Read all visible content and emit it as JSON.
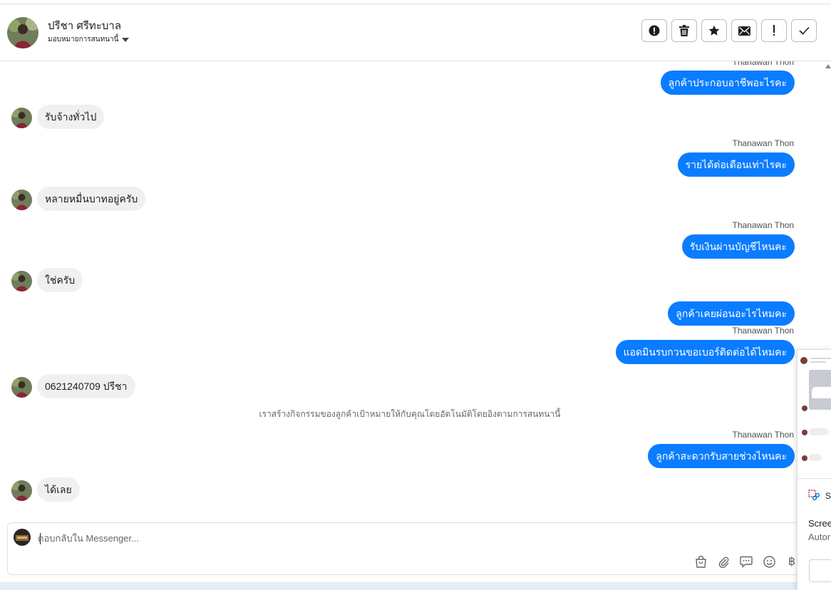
{
  "header": {
    "contact_name": "ปรีชา ศรีทะบาล",
    "assign_label": "มอบหมายการสนทนานี้",
    "actions": [
      {
        "id": "report",
        "icon": "alert-circle-icon"
      },
      {
        "id": "delete",
        "icon": "trash-icon"
      },
      {
        "id": "star",
        "icon": "star-icon"
      },
      {
        "id": "mail",
        "icon": "envelope-icon"
      },
      {
        "id": "important",
        "icon": "exclamation-icon"
      },
      {
        "id": "done",
        "icon": "check-icon"
      }
    ]
  },
  "messages": {
    "top_sender": "Thanawan Thon",
    "out_1": "ลูกค้าประกอบอาชีพอะไรคะ",
    "in_1": "รับจ้างทั่วไป",
    "sender_2": "Thanawan Thon",
    "out_2": "รายได้ต่อเดือนเท่าไรคะ",
    "in_2": "หลายหมื่นบาทอยู่ครับ",
    "sender_3": "Thanawan Thon",
    "out_3": "รับเงินผ่านบัญชีไหนคะ",
    "in_3": "ใช่ครับ",
    "out_4": "ลูกค้าเคยผ่อนอะไรไหมคะ",
    "sender_4": "Thanawan Thon",
    "out_5": "แอดมินรบกวนขอเบอร์ติดต่อได้ไหมคะ",
    "in_4": "0621240709 ปรีชา",
    "system_note": "เราสร้างกิจกรรมของลูกค้าเป้าหมายให้กับคุณโดยอัตโนมัติโดยอิงตามการสนทนานี้",
    "sender_5": "Thanawan Thon",
    "out_6": "ลูกค้าสะดวกรับสายช่วงไหนคะ",
    "in_5": "ได้เลย"
  },
  "composer": {
    "placeholder": "ตอบกลับใน Messenger...",
    "value": "",
    "tools": [
      "shopping-bag-icon",
      "paperclip-icon",
      "chat-bubble-icon",
      "emoji-icon",
      "baht-icon"
    ],
    "baht_glyph": "฿"
  },
  "overlay": {
    "brand": "Sn",
    "text_1": "Scree",
    "text_2": "Autor"
  },
  "colors": {
    "outgoing_bubble": "#0a7cff",
    "incoming_bubble": "#f0f0f0",
    "border": "#dddfe2"
  }
}
